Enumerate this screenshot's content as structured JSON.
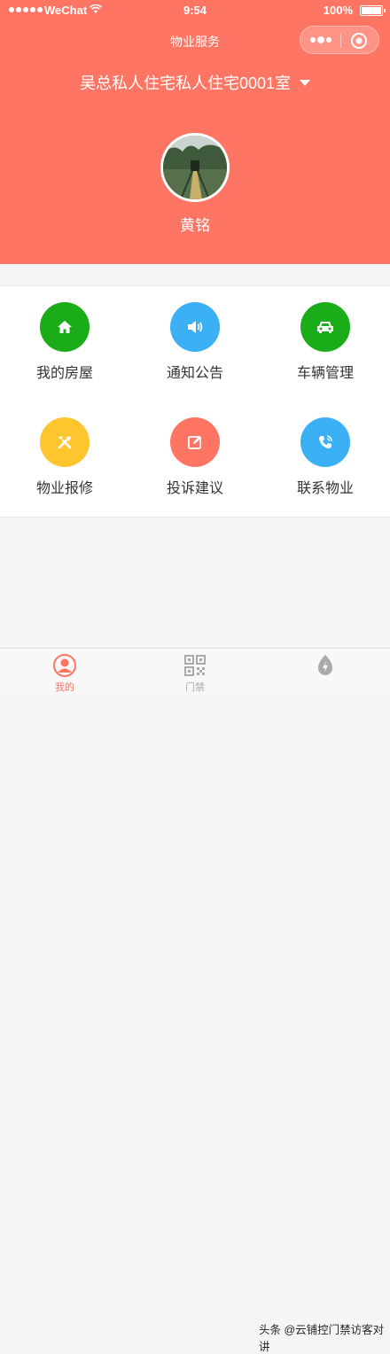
{
  "status_bar": {
    "carrier": "WeChat",
    "time": "9:54",
    "battery": "100%"
  },
  "nav": {
    "title": "物业服务"
  },
  "header": {
    "address": "吴总私人住宅私人住宅0001室",
    "user_name": "黄铭"
  },
  "colors": {
    "header_bg": "#ff7563",
    "green": "#1aad19",
    "blue": "#3bb0f5",
    "yellow": "#ffc52e",
    "coral": "#ff7563"
  },
  "services": [
    {
      "label": "我的房屋",
      "icon": "home-icon",
      "color": "#1aad19"
    },
    {
      "label": "通知公告",
      "icon": "speaker-icon",
      "color": "#3bb0f5"
    },
    {
      "label": "车辆管理",
      "icon": "car-icon",
      "color": "#1aad19"
    },
    {
      "label": "物业报修",
      "icon": "tools-icon",
      "color": "#ffc52e"
    },
    {
      "label": "投诉建议",
      "icon": "edit-icon",
      "color": "#ff7563"
    },
    {
      "label": "联系物业",
      "icon": "phone-icon",
      "color": "#3bb0f5"
    }
  ],
  "tabbar": [
    {
      "label": "我的",
      "icon": "user-icon",
      "active": true
    },
    {
      "label": "门禁",
      "icon": "qrcode-icon",
      "active": false
    },
    {
      "label": "",
      "icon": "flash-icon",
      "active": false
    }
  ],
  "watermark": "头条 @云铺控门禁访客对讲"
}
